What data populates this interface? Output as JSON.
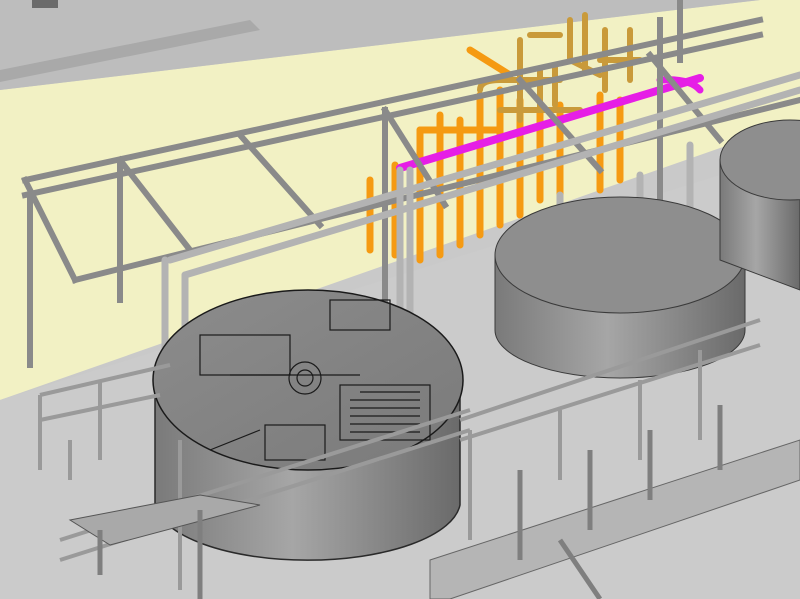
{
  "scene": {
    "kind": "3d-plant-model-render",
    "colors": {
      "wall": "#f2f1c4",
      "floor": "#c8c8c8",
      "steel": "#8f8f8f",
      "steel_dark": "#5a5a5a",
      "tank": "#9a9a9a",
      "tank_dark": "#6e6e6e",
      "orange_pipe": "#f59a12",
      "gold_pipe": "#c99a3a",
      "magenta_pipe": "#e61ee6",
      "outline": "#222222"
    }
  }
}
